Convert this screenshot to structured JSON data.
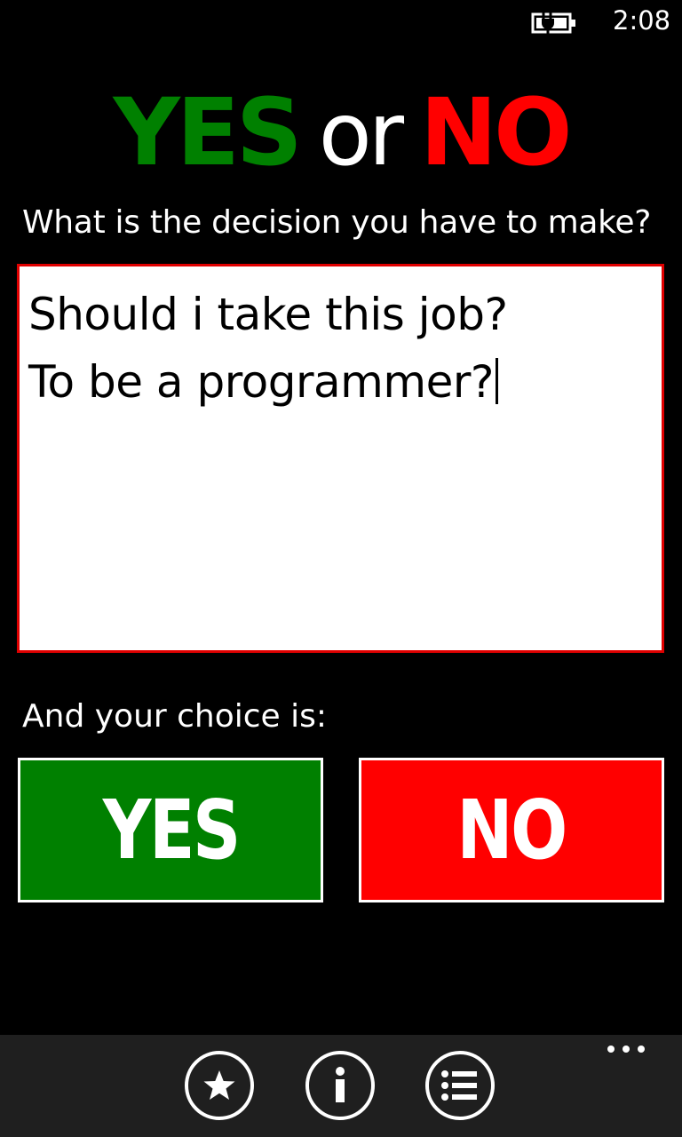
{
  "status_bar": {
    "time": "2:08",
    "battery_icon": "battery-charging-icon"
  },
  "title": {
    "yes": "YES",
    "or": "or",
    "no": "NO",
    "colors": {
      "yes": "#008000",
      "or": "#ffffff",
      "no": "#ff0000"
    }
  },
  "prompt": "What is the decision you have to make?",
  "decision_input": {
    "value": "Should i take this job?\nTo be a programmer?",
    "border_color": "#e00000"
  },
  "choice_label": "And your choice is:",
  "buttons": {
    "yes": {
      "label": "YES",
      "color": "#008000"
    },
    "no": {
      "label": "NO",
      "color": "#ff0000"
    }
  },
  "app_bar": {
    "icons": [
      "star-icon",
      "info-icon",
      "list-icon"
    ],
    "more_icon": "more-ellipsis-icon"
  }
}
